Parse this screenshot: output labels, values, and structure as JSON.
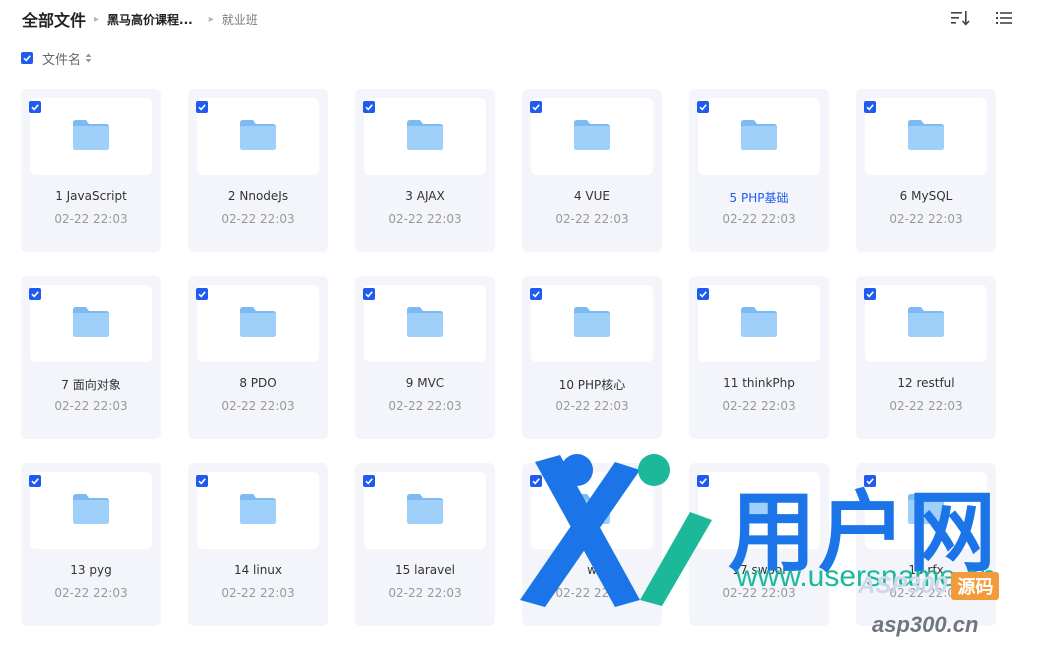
{
  "breadcrumb": {
    "root": "全部文件",
    "middle": "黑马高价课程...",
    "current": "就业班"
  },
  "toolbar": {
    "sort_label": "文件名"
  },
  "header_icons": [
    "sort-icon",
    "list-view-icon"
  ],
  "colors": {
    "accent": "#1f5bf0",
    "card_bg": "#f3f5fb",
    "folder": "#8cc4f7"
  },
  "folders": [
    {
      "name": "1 JavaScript",
      "date": "02-22 22:03",
      "highlighted": false
    },
    {
      "name": "2 NnodeJs",
      "date": "02-22 22:03",
      "highlighted": false
    },
    {
      "name": "3 AJAX",
      "date": "02-22 22:03",
      "highlighted": false
    },
    {
      "name": "4 VUE",
      "date": "02-22 22:03",
      "highlighted": false
    },
    {
      "name": "5 PHP基础",
      "date": "02-22 22:03",
      "highlighted": true
    },
    {
      "name": "6 MySQL",
      "date": "02-22 22:03",
      "highlighted": false
    },
    {
      "name": "7 面向对象",
      "date": "02-22 22:03",
      "highlighted": false
    },
    {
      "name": "8 PDO",
      "date": "02-22 22:03",
      "highlighted": false
    },
    {
      "name": "9 MVC",
      "date": "02-22 22:03",
      "highlighted": false
    },
    {
      "name": "10 PHP核心",
      "date": "02-22 22:03",
      "highlighted": false
    },
    {
      "name": "11 thinkPhp",
      "date": "02-22 22:03",
      "highlighted": false
    },
    {
      "name": "12 restful",
      "date": "02-22 22:03",
      "highlighted": false
    },
    {
      "name": "13 pyg",
      "date": "02-22 22:03",
      "highlighted": false
    },
    {
      "name": "14 linux",
      "date": "02-22 22:03",
      "highlighted": false
    },
    {
      "name": "15 laravel",
      "date": "02-22 22:03",
      "highlighted": false
    },
    {
      "name": "w",
      "date": "02-22 22:03",
      "highlighted": false
    },
    {
      "name": "17 swool",
      "date": "02-22 22:03",
      "highlighted": false
    },
    {
      "name": "18 rfx",
      "date": "02-22 22:03",
      "highlighted": false
    }
  ],
  "watermark": {
    "brand": "用户网",
    "url": "www.usersname.cn",
    "site_badge_left": "ASP300",
    "site_badge_right": "源码",
    "site_url": "asp300.cn"
  }
}
